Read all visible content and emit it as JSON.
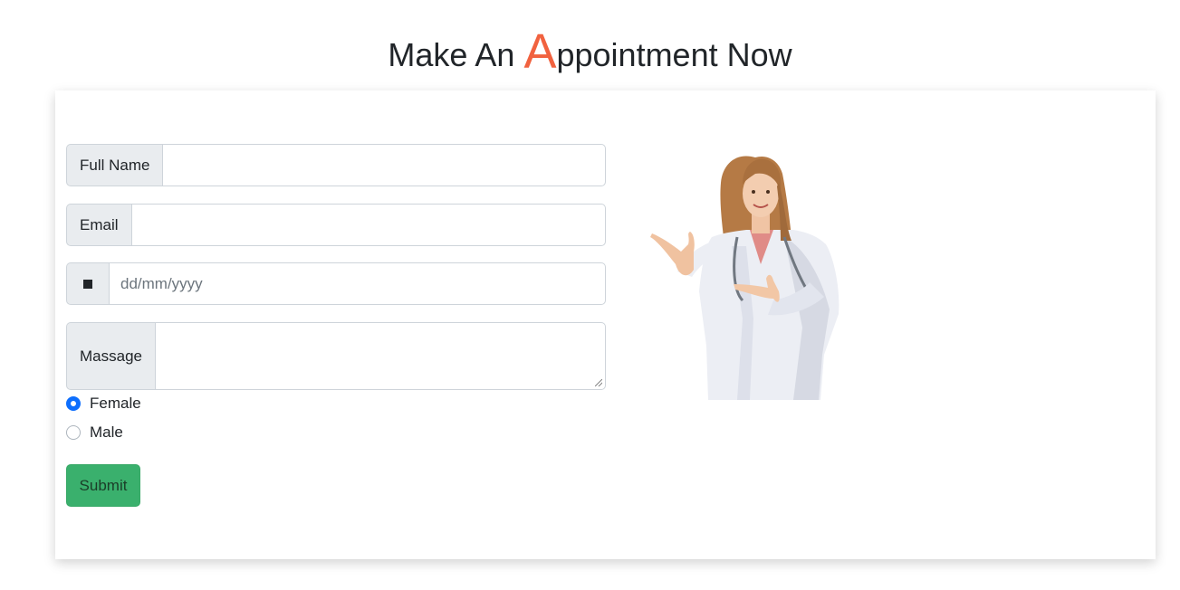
{
  "title": {
    "prefix": "Make An ",
    "accent_letter": "A",
    "suffix": "ppointment Now",
    "accent_color": "#f1623f"
  },
  "form": {
    "full_name": {
      "label": "Full Name",
      "value": ""
    },
    "email": {
      "label": "Email",
      "value": ""
    },
    "date": {
      "icon": "calendar-icon",
      "placeholder": "dd/mm/yyyy",
      "value": ""
    },
    "message": {
      "label": "Massage",
      "value": ""
    },
    "gender": {
      "options": [
        {
          "label": "Female",
          "checked": true
        },
        {
          "label": "Male",
          "checked": false
        }
      ]
    },
    "submit_label": "Submit",
    "submit_color": "#3ab06d"
  },
  "illustration": {
    "subject": "doctor-pointing-image"
  }
}
